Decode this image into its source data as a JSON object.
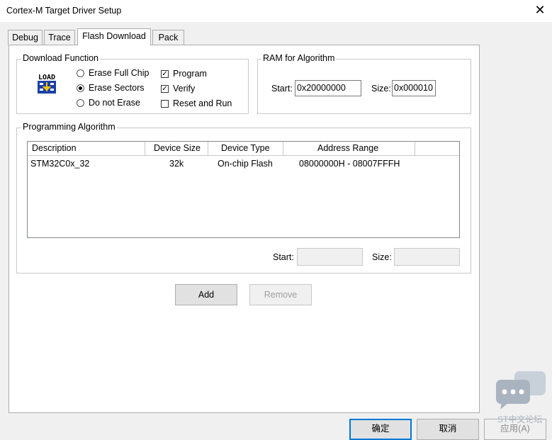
{
  "window": {
    "title": "Cortex-M Target Driver Setup",
    "close_label": "✕"
  },
  "tabs": [
    {
      "label": "Debug"
    },
    {
      "label": "Trace"
    },
    {
      "label": "Flash Download"
    },
    {
      "label": "Pack"
    }
  ],
  "download_function": {
    "legend": "Download Function",
    "icon_label": "LOAD",
    "radios": [
      {
        "label": "Erase Full Chip",
        "selected": false
      },
      {
        "label": "Erase Sectors",
        "selected": true
      },
      {
        "label": "Do not Erase",
        "selected": false
      }
    ],
    "checks": [
      {
        "label": "Program",
        "checked": true
      },
      {
        "label": "Verify",
        "checked": true
      },
      {
        "label": "Reset and Run",
        "checked": false
      }
    ]
  },
  "ram": {
    "legend": "RAM for Algorithm",
    "start_label": "Start:",
    "start_value": "0x20000000",
    "size_label": "Size:",
    "size_value": "0x000010"
  },
  "programming": {
    "legend": "Programming Algorithm",
    "columns": [
      "Description",
      "Device Size",
      "Device Type",
      "Address Range"
    ],
    "rows": [
      {
        "description": "STM32C0x_32",
        "size": "32k",
        "type": "On-chip Flash",
        "range": "08000000H - 08007FFFH"
      }
    ],
    "start_label": "Start:",
    "start_value": "",
    "size_label": "Size:",
    "size_value": ""
  },
  "buttons": {
    "add": "Add",
    "remove": "Remove"
  },
  "footer": {
    "ok": "确定",
    "cancel": "取消",
    "apply": "应用(A)"
  },
  "watermark": {
    "text": "ST中文论坛"
  }
}
